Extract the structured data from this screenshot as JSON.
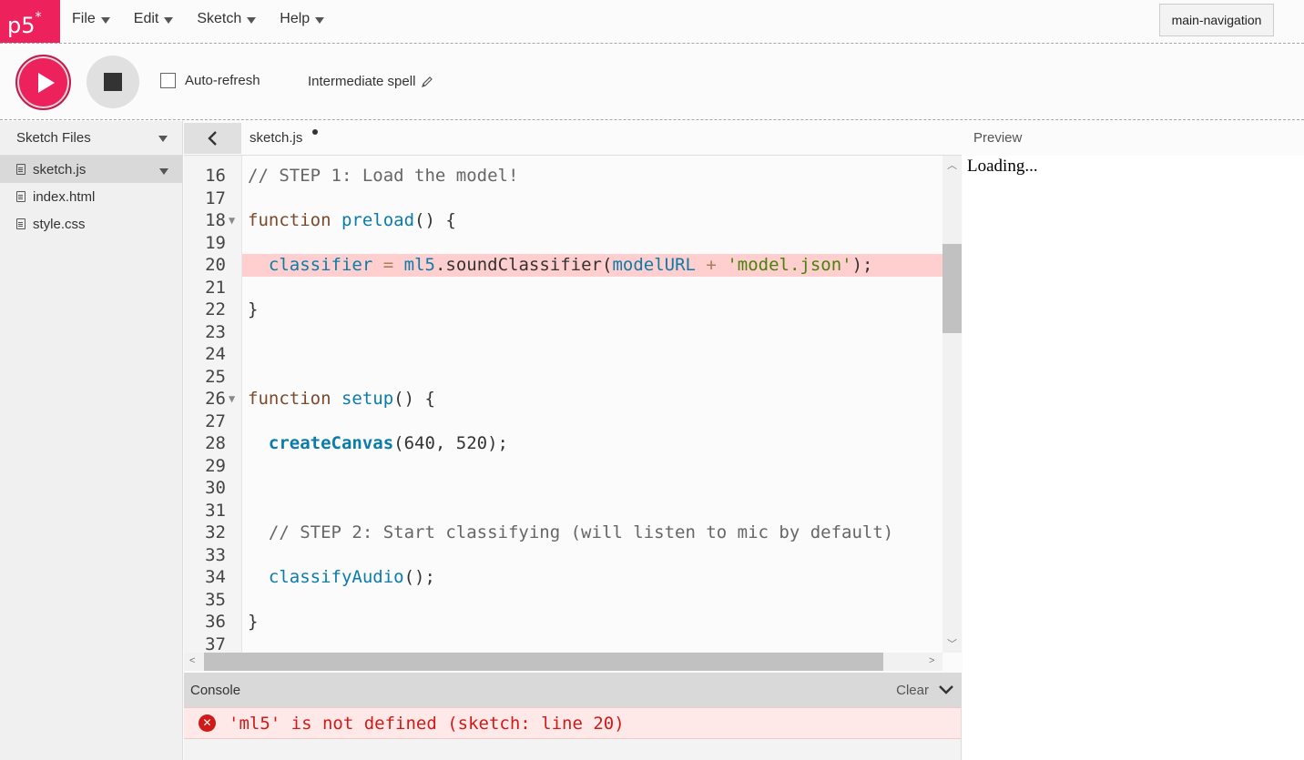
{
  "app": {
    "logo": "p5",
    "logo_sup": "*"
  },
  "menu": [
    {
      "label": "File"
    },
    {
      "label": "Edit"
    },
    {
      "label": "Sketch"
    },
    {
      "label": "Help"
    }
  ],
  "toolbar": {
    "auto_refresh_label": "Auto-refresh",
    "auto_refresh_checked": false,
    "sketch_name": "Intermediate spell",
    "tooltip": "main-navigation"
  },
  "sidebar": {
    "title": "Sketch Files",
    "files": [
      {
        "name": "sketch.js",
        "active": true
      },
      {
        "name": "index.html",
        "active": false
      },
      {
        "name": "style.css",
        "active": false
      }
    ]
  },
  "editor": {
    "tab_name": "sketch.js",
    "lines": [
      {
        "n": "16",
        "html": "<span class=\"c-comment\">// STEP 1: Load the model!</span>"
      },
      {
        "n": "17",
        "html": ""
      },
      {
        "n": "18",
        "fold": true,
        "html": "<span class=\"c-kw\">function</span> <span class=\"c-def\">preload</span>() {"
      },
      {
        "n": "19",
        "html": ""
      },
      {
        "n": "20",
        "highlight": true,
        "html": "  <span class=\"c-def\">classifier</span> <span class=\"c-op\">=</span> <span class=\"c-def\">ml5</span>.soundClassifier(<span class=\"c-def\">modelURL</span> <span class=\"c-op\">+</span> <span class=\"c-str\">'model.json'</span>);"
      },
      {
        "n": "21",
        "html": ""
      },
      {
        "n": "22",
        "html": "}"
      },
      {
        "n": "23",
        "html": ""
      },
      {
        "n": "24",
        "html": ""
      },
      {
        "n": "25",
        "html": ""
      },
      {
        "n": "26",
        "fold": true,
        "html": "<span class=\"c-kw\">function</span> <span class=\"c-def\">setup</span>() {"
      },
      {
        "n": "27",
        "html": ""
      },
      {
        "n": "28",
        "html": "  <span class=\"c-bold\">createCanvas</span>(640, 520);"
      },
      {
        "n": "29",
        "html": ""
      },
      {
        "n": "30",
        "html": ""
      },
      {
        "n": "31",
        "html": ""
      },
      {
        "n": "32",
        "html": "  <span class=\"c-comment\">// STEP 2: Start classifying (will listen to mic by default)</span>"
      },
      {
        "n": "33",
        "html": ""
      },
      {
        "n": "34",
        "html": "  <span class=\"c-def\">classifyAudio</span>();"
      },
      {
        "n": "35",
        "html": ""
      },
      {
        "n": "36",
        "html": "}"
      },
      {
        "n": "37",
        "html": ""
      }
    ]
  },
  "console": {
    "title": "Console",
    "clear_label": "Clear",
    "error": "'ml5' is not defined (sketch: line 20)"
  },
  "preview": {
    "title": "Preview",
    "content": "Loading..."
  }
}
